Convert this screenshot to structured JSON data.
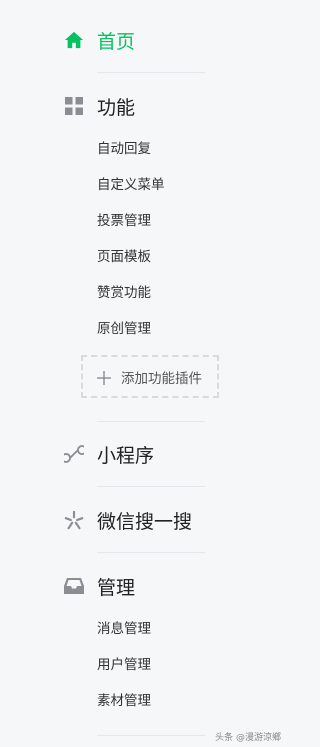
{
  "colors": {
    "accent": "#07c160",
    "icon_gray": "#8a8d91",
    "background": "#f6f7f9"
  },
  "nav": {
    "home": {
      "label": "首页",
      "icon": "home-icon",
      "active": true
    },
    "features": {
      "label": "功能",
      "icon": "grid-icon",
      "items": [
        {
          "label": "自动回复"
        },
        {
          "label": "自定义菜单"
        },
        {
          "label": "投票管理"
        },
        {
          "label": "页面模板"
        },
        {
          "label": "赞赏功能"
        },
        {
          "label": "原创管理"
        }
      ],
      "add_plugin_label": "添加功能插件"
    },
    "mini_program": {
      "label": "小程序",
      "icon": "mini-program-icon"
    },
    "wechat_search": {
      "label": "微信搜一搜",
      "icon": "search-star-icon"
    },
    "management": {
      "label": "管理",
      "icon": "inbox-icon",
      "items": [
        {
          "label": "消息管理"
        },
        {
          "label": "用户管理"
        },
        {
          "label": "素材管理"
        }
      ]
    }
  },
  "watermark": {
    "text": "头条 @漫游涼鄉"
  }
}
